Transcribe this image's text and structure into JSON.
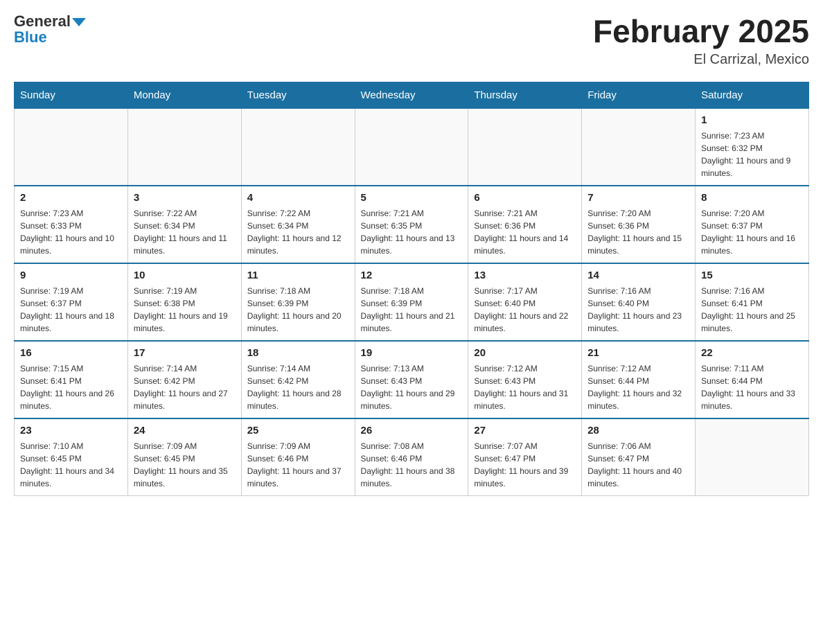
{
  "logo": {
    "general": "General",
    "blue": "Blue"
  },
  "title": "February 2025",
  "subtitle": "El Carrizal, Mexico",
  "weekdays": [
    "Sunday",
    "Monday",
    "Tuesday",
    "Wednesday",
    "Thursday",
    "Friday",
    "Saturday"
  ],
  "weeks": [
    [
      {
        "day": "",
        "info": ""
      },
      {
        "day": "",
        "info": ""
      },
      {
        "day": "",
        "info": ""
      },
      {
        "day": "",
        "info": ""
      },
      {
        "day": "",
        "info": ""
      },
      {
        "day": "",
        "info": ""
      },
      {
        "day": "1",
        "info": "Sunrise: 7:23 AM\nSunset: 6:32 PM\nDaylight: 11 hours and 9 minutes."
      }
    ],
    [
      {
        "day": "2",
        "info": "Sunrise: 7:23 AM\nSunset: 6:33 PM\nDaylight: 11 hours and 10 minutes."
      },
      {
        "day": "3",
        "info": "Sunrise: 7:22 AM\nSunset: 6:34 PM\nDaylight: 11 hours and 11 minutes."
      },
      {
        "day": "4",
        "info": "Sunrise: 7:22 AM\nSunset: 6:34 PM\nDaylight: 11 hours and 12 minutes."
      },
      {
        "day": "5",
        "info": "Sunrise: 7:21 AM\nSunset: 6:35 PM\nDaylight: 11 hours and 13 minutes."
      },
      {
        "day": "6",
        "info": "Sunrise: 7:21 AM\nSunset: 6:36 PM\nDaylight: 11 hours and 14 minutes."
      },
      {
        "day": "7",
        "info": "Sunrise: 7:20 AM\nSunset: 6:36 PM\nDaylight: 11 hours and 15 minutes."
      },
      {
        "day": "8",
        "info": "Sunrise: 7:20 AM\nSunset: 6:37 PM\nDaylight: 11 hours and 16 minutes."
      }
    ],
    [
      {
        "day": "9",
        "info": "Sunrise: 7:19 AM\nSunset: 6:37 PM\nDaylight: 11 hours and 18 minutes."
      },
      {
        "day": "10",
        "info": "Sunrise: 7:19 AM\nSunset: 6:38 PM\nDaylight: 11 hours and 19 minutes."
      },
      {
        "day": "11",
        "info": "Sunrise: 7:18 AM\nSunset: 6:39 PM\nDaylight: 11 hours and 20 minutes."
      },
      {
        "day": "12",
        "info": "Sunrise: 7:18 AM\nSunset: 6:39 PM\nDaylight: 11 hours and 21 minutes."
      },
      {
        "day": "13",
        "info": "Sunrise: 7:17 AM\nSunset: 6:40 PM\nDaylight: 11 hours and 22 minutes."
      },
      {
        "day": "14",
        "info": "Sunrise: 7:16 AM\nSunset: 6:40 PM\nDaylight: 11 hours and 23 minutes."
      },
      {
        "day": "15",
        "info": "Sunrise: 7:16 AM\nSunset: 6:41 PM\nDaylight: 11 hours and 25 minutes."
      }
    ],
    [
      {
        "day": "16",
        "info": "Sunrise: 7:15 AM\nSunset: 6:41 PM\nDaylight: 11 hours and 26 minutes."
      },
      {
        "day": "17",
        "info": "Sunrise: 7:14 AM\nSunset: 6:42 PM\nDaylight: 11 hours and 27 minutes."
      },
      {
        "day": "18",
        "info": "Sunrise: 7:14 AM\nSunset: 6:42 PM\nDaylight: 11 hours and 28 minutes."
      },
      {
        "day": "19",
        "info": "Sunrise: 7:13 AM\nSunset: 6:43 PM\nDaylight: 11 hours and 29 minutes."
      },
      {
        "day": "20",
        "info": "Sunrise: 7:12 AM\nSunset: 6:43 PM\nDaylight: 11 hours and 31 minutes."
      },
      {
        "day": "21",
        "info": "Sunrise: 7:12 AM\nSunset: 6:44 PM\nDaylight: 11 hours and 32 minutes."
      },
      {
        "day": "22",
        "info": "Sunrise: 7:11 AM\nSunset: 6:44 PM\nDaylight: 11 hours and 33 minutes."
      }
    ],
    [
      {
        "day": "23",
        "info": "Sunrise: 7:10 AM\nSunset: 6:45 PM\nDaylight: 11 hours and 34 minutes."
      },
      {
        "day": "24",
        "info": "Sunrise: 7:09 AM\nSunset: 6:45 PM\nDaylight: 11 hours and 35 minutes."
      },
      {
        "day": "25",
        "info": "Sunrise: 7:09 AM\nSunset: 6:46 PM\nDaylight: 11 hours and 37 minutes."
      },
      {
        "day": "26",
        "info": "Sunrise: 7:08 AM\nSunset: 6:46 PM\nDaylight: 11 hours and 38 minutes."
      },
      {
        "day": "27",
        "info": "Sunrise: 7:07 AM\nSunset: 6:47 PM\nDaylight: 11 hours and 39 minutes."
      },
      {
        "day": "28",
        "info": "Sunrise: 7:06 AM\nSunset: 6:47 PM\nDaylight: 11 hours and 40 minutes."
      },
      {
        "day": "",
        "info": ""
      }
    ]
  ]
}
